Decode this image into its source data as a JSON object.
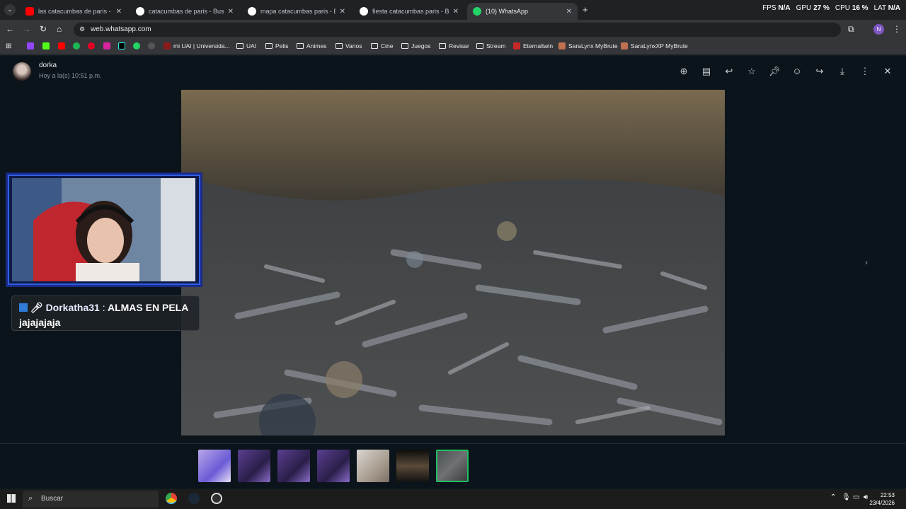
{
  "browser": {
    "tabs": [
      {
        "title": "las catacumbas de paris - YouTu",
        "active": false
      },
      {
        "title": "catacumbas de paris - Buscar c",
        "active": false
      },
      {
        "title": "mapa catacumbas paris - Buscar",
        "active": false
      },
      {
        "title": "fiesta catacumbas paris - Buscar",
        "active": false
      },
      {
        "title": "(10) WhatsApp",
        "active": true
      }
    ],
    "url": "web.whatsapp.com",
    "perf": {
      "fps_label": "FPS",
      "fps": "N/A",
      "gpu_label": "GPU",
      "gpu": "27 %",
      "cpu_label": "CPU",
      "cpu": "16 %",
      "lat_label": "LAT",
      "lat": "N/A"
    },
    "profile_initial": "N",
    "bookmarks": [
      "mi UAI | Universida...",
      "UAI",
      "Pelis",
      "Animes",
      "Varios",
      "Cine",
      "Juegos",
      "Revisar",
      "Stream",
      "Eternaltwin",
      "SaraLynx MyBrute",
      "SaraLynxXP MyBrute"
    ]
  },
  "viewer": {
    "contact_name": "dorka",
    "contact_time": "Hoy a la(s) 10:51 p.m.",
    "toolbar_icons": [
      "zoom-in-icon",
      "caption-icon",
      "reply-icon",
      "star-icon",
      "pin-icon",
      "emoji-icon",
      "forward-icon",
      "download-icon",
      "menu-icon",
      "close-icon"
    ],
    "thumbnails": 7,
    "selected_thumbnail": 7
  },
  "overlay": {
    "chat_user": "Dorkatha31",
    "chat_sep": ":",
    "chat_message": "ALMAS EN PELA jajajajaja"
  },
  "taskbar": {
    "search_placeholder": "Buscar",
    "time": "22:53",
    "date": "23/4/2026"
  }
}
